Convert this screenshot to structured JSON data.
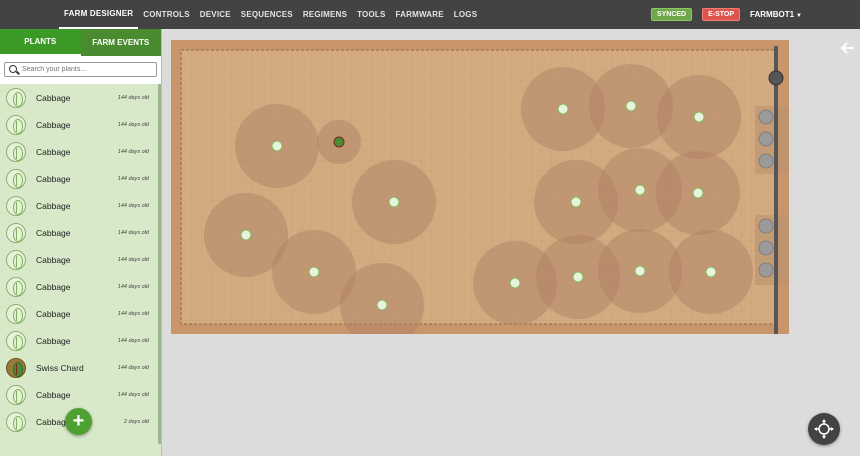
{
  "nav": {
    "links": [
      "FARM DESIGNER",
      "CONTROLS",
      "DEVICE",
      "SEQUENCES",
      "REGIMENS",
      "TOOLS",
      "FARMWARE",
      "LOGS"
    ],
    "synced": "SYNCED",
    "estop": "E-STOP",
    "device": "FARMBOT1"
  },
  "panel": {
    "tabs": [
      "PLANTS",
      "FARM EVENTS"
    ],
    "search_placeholder": "Search your plants...",
    "plants": [
      {
        "name": "Cabbage",
        "age": "144 days old",
        "icon": "cabbage-icon"
      },
      {
        "name": "Cabbage",
        "age": "144 days old",
        "icon": "cabbage-icon"
      },
      {
        "name": "Cabbage",
        "age": "144 days old",
        "icon": "cabbage-icon"
      },
      {
        "name": "Cabbage",
        "age": "144 days old",
        "icon": "cabbage-icon"
      },
      {
        "name": "Cabbage",
        "age": "144 days old",
        "icon": "cabbage-icon"
      },
      {
        "name": "Cabbage",
        "age": "144 days old",
        "icon": "cabbage-icon"
      },
      {
        "name": "Cabbage",
        "age": "144 days old",
        "icon": "cabbage-icon"
      },
      {
        "name": "Cabbage",
        "age": "144 days old",
        "icon": "cabbage-icon"
      },
      {
        "name": "Cabbage",
        "age": "144 days old",
        "icon": "cabbage-icon"
      },
      {
        "name": "Cabbage",
        "age": "144 days old",
        "icon": "cabbage-icon"
      },
      {
        "name": "Swiss Chard",
        "age": "144 days old",
        "icon": "swiss-chard-icon"
      },
      {
        "name": "Cabbage",
        "age": "144 days old",
        "icon": "cabbage-icon"
      },
      {
        "name": "Cabbage",
        "age": "2 days old",
        "icon": "cabbage-icon"
      }
    ]
  },
  "colors": {
    "nav_bg": "#434343",
    "panel_tab_bg": "#4b8b2f",
    "list_bg": "#d8e9c9",
    "soil": "#d3a97f",
    "plant_spread": "#b38a68",
    "synced": "#6fa84a",
    "estop": "#e0544d"
  }
}
